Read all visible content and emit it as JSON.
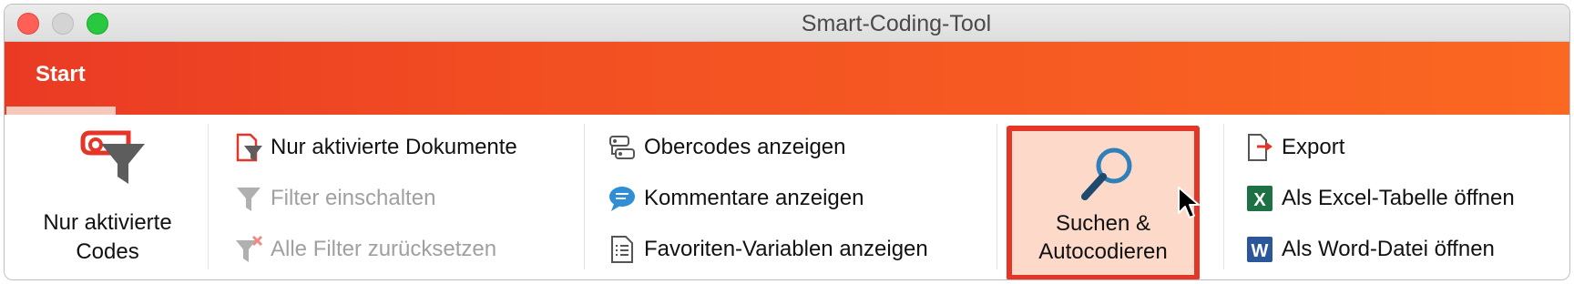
{
  "window": {
    "title": "Smart-Coding-Tool"
  },
  "ribbon": {
    "active_tab": "Start"
  },
  "groups": {
    "codes_filter": {
      "label_line1": "Nur aktivierte",
      "label_line2": "Codes"
    },
    "doc_filter": {
      "items": [
        {
          "label": "Nur aktivierte Dokumente",
          "enabled": true
        },
        {
          "label": "Filter einschalten",
          "enabled": false
        },
        {
          "label": "Alle Filter zurücksetzen",
          "enabled": false
        }
      ]
    },
    "view": {
      "items": [
        {
          "label": "Obercodes anzeigen"
        },
        {
          "label": "Kommentare anzeigen"
        },
        {
          "label": "Favoriten-Variablen anzeigen"
        }
      ]
    },
    "search": {
      "label_line1": "Suchen &",
      "label_line2": "Autocodieren",
      "highlighted": true
    },
    "export": {
      "items": [
        {
          "label": "Export",
          "icon": "export-icon"
        },
        {
          "label": "Als Excel-Tabelle öffnen",
          "icon": "excel-icon",
          "glyph": "X"
        },
        {
          "label": "Als Word-Datei öffnen",
          "icon": "word-icon",
          "glyph": "W"
        }
      ]
    }
  },
  "colors": {
    "accent": "#e53527",
    "ribbon_start": "#ea3a24",
    "ribbon_end": "#fb6822",
    "excel": "#1e7145",
    "word": "#2b579a"
  }
}
